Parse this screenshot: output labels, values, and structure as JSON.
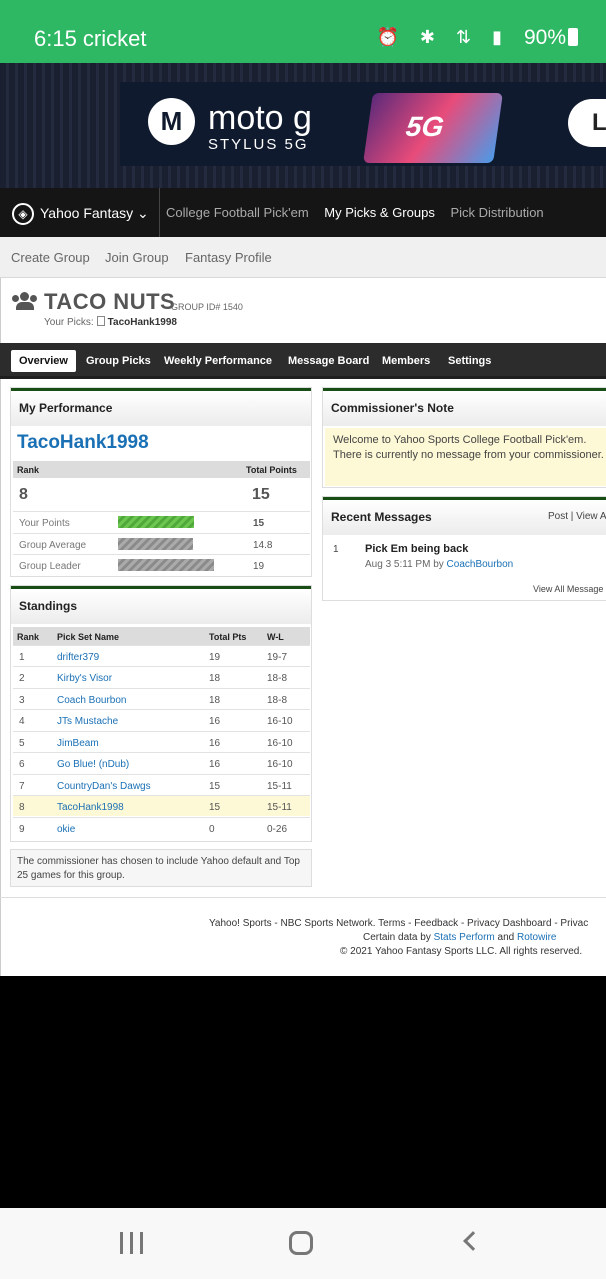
{
  "status_bar": {
    "time_carrier": "6:15 cricket",
    "icons": "⏰ ✱ ⇅ ▮",
    "battery": "90%"
  },
  "ad": {
    "brand": "moto g",
    "sub": "STYLUS 5G",
    "phone_label": "5G",
    "cta": "L"
  },
  "yahoo_nav": {
    "brand": "Yahoo Fantasy ⌄",
    "links": [
      "College Football Pick'em",
      "My Picks & Groups",
      "Pick Distribution"
    ]
  },
  "sub_nav": [
    "Create Group",
    "Join Group",
    "Fantasy Profile"
  ],
  "group": {
    "title": "TACO NUTS",
    "id_label": "GROUP ID# 1540",
    "your_picks_label": "Your Picks:",
    "your_picks_name": "TacoHank1998"
  },
  "group_tabs": [
    "Overview",
    "Group Picks",
    "Weekly Performance",
    "Message Board",
    "Members",
    "Settings"
  ],
  "performance": {
    "title": "My Performance",
    "username": "TacoHank1998",
    "rank_header": "Rank",
    "points_header": "Total Points",
    "rank": "8",
    "total_points": "15",
    "rows": [
      {
        "label": "Your Points",
        "value": "15"
      },
      {
        "label": "Group Average",
        "value": "14.8"
      },
      {
        "label": "Group Leader",
        "value": "19"
      }
    ]
  },
  "standings": {
    "title": "Standings",
    "headers": [
      "Rank",
      "Pick Set Name",
      "Total Pts",
      "W-L"
    ],
    "rows": [
      {
        "rank": "1",
        "name": "drifter379",
        "pts": "19",
        "wl": "19-7"
      },
      {
        "rank": "2",
        "name": "Kirby's Visor",
        "pts": "18",
        "wl": "18-8"
      },
      {
        "rank": "3",
        "name": "Coach Bourbon",
        "pts": "18",
        "wl": "18-8"
      },
      {
        "rank": "4",
        "name": "JTs Mustache",
        "pts": "16",
        "wl": "16-10"
      },
      {
        "rank": "5",
        "name": "JimBeam",
        "pts": "16",
        "wl": "16-10"
      },
      {
        "rank": "6",
        "name": "Go Blue! (nDub)",
        "pts": "16",
        "wl": "16-10"
      },
      {
        "rank": "7",
        "name": "CountryDan's Dawgs",
        "pts": "15",
        "wl": "15-11"
      },
      {
        "rank": "8",
        "name": "TacoHank1998",
        "pts": "15",
        "wl": "15-11"
      },
      {
        "rank": "9",
        "name": "okie",
        "pts": "0",
        "wl": "0-26"
      }
    ]
  },
  "games_note": "The commissioner has chosen to include Yahoo default and Top 25 games for this group.",
  "commissioner": {
    "title": "Commissioner's Note",
    "message": "Welcome to Yahoo Sports College Football Pick'em. There is currently no message from your commissioner."
  },
  "recent": {
    "title": "Recent Messages",
    "links": "Post | View A",
    "item_number": "1",
    "item_title": "Pick Em being back",
    "item_date": "Aug 3 5:11 PM by",
    "item_author": "CoachBourbon",
    "view_all": "View All Message"
  },
  "footer": {
    "line1": "Yahoo! Sports - NBC Sports Network. Terms - Feedback - Privacy Dashboard - Privac",
    "line2_prefix": "Certain data by",
    "line2_link1": "Stats Perform",
    "line2_and": "and",
    "line2_link2": "Rotowire",
    "line3": "© 2021 Yahoo Fantasy Sports LLC. All rights reserved."
  }
}
